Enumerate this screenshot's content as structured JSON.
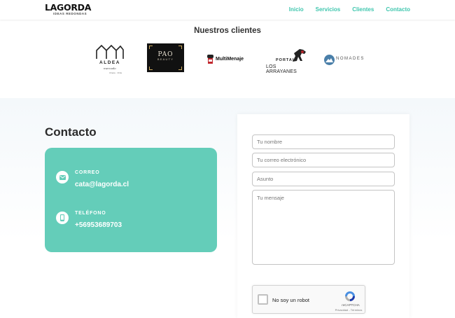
{
  "header": {
    "logo_main": "LAGORDA",
    "logo_sub": "IDEAS REDONDAS",
    "nav": [
      "Inicio",
      "Servicios",
      "Clientes",
      "Contacto"
    ]
  },
  "clients": {
    "title": "Nuestros clientes",
    "logos": {
      "aldea": "ALDEA",
      "aldea_sub": "mercado",
      "aldea_sub2": "Chaca · Chile",
      "pao": "PAO",
      "pao_sub": "BEAUTY",
      "multimenaje": "MultiMenaje",
      "portal": "PORTAL",
      "arrayanes": "LOS ARRAYANES",
      "nomades": "NOMADES"
    }
  },
  "contact": {
    "title": "Contacto",
    "email_label": "CORREO",
    "email_value": "cata@lagorda.cl",
    "phone_label": "TELÉFONO",
    "phone_value": "+56953689703"
  },
  "form": {
    "name_placeholder": "Tu nombre",
    "email_placeholder": "Tu correo electrónico",
    "subject_placeholder": "Asunto",
    "message_placeholder": "Tu mensaje"
  },
  "recaptcha": {
    "label": "No soy un robot",
    "brand": "reCAPTCHA",
    "terms": "Privacidad - Términos"
  },
  "colors": {
    "accent": "#3fc6ae",
    "card": "#64cdb9"
  }
}
